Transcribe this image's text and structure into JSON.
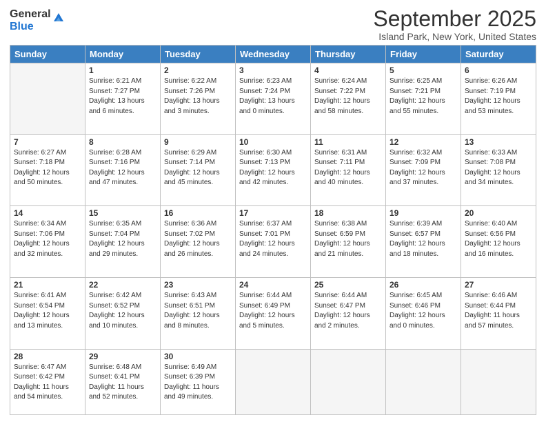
{
  "logo": {
    "general": "General",
    "blue": "Blue"
  },
  "title": "September 2025",
  "location": "Island Park, New York, United States",
  "days_of_week": [
    "Sunday",
    "Monday",
    "Tuesday",
    "Wednesday",
    "Thursday",
    "Friday",
    "Saturday"
  ],
  "weeks": [
    [
      {
        "day": "",
        "info": ""
      },
      {
        "day": "1",
        "info": "Sunrise: 6:21 AM\nSunset: 7:27 PM\nDaylight: 13 hours\nand 6 minutes."
      },
      {
        "day": "2",
        "info": "Sunrise: 6:22 AM\nSunset: 7:26 PM\nDaylight: 13 hours\nand 3 minutes."
      },
      {
        "day": "3",
        "info": "Sunrise: 6:23 AM\nSunset: 7:24 PM\nDaylight: 13 hours\nand 0 minutes."
      },
      {
        "day": "4",
        "info": "Sunrise: 6:24 AM\nSunset: 7:22 PM\nDaylight: 12 hours\nand 58 minutes."
      },
      {
        "day": "5",
        "info": "Sunrise: 6:25 AM\nSunset: 7:21 PM\nDaylight: 12 hours\nand 55 minutes."
      },
      {
        "day": "6",
        "info": "Sunrise: 6:26 AM\nSunset: 7:19 PM\nDaylight: 12 hours\nand 53 minutes."
      }
    ],
    [
      {
        "day": "7",
        "info": "Sunrise: 6:27 AM\nSunset: 7:18 PM\nDaylight: 12 hours\nand 50 minutes."
      },
      {
        "day": "8",
        "info": "Sunrise: 6:28 AM\nSunset: 7:16 PM\nDaylight: 12 hours\nand 47 minutes."
      },
      {
        "day": "9",
        "info": "Sunrise: 6:29 AM\nSunset: 7:14 PM\nDaylight: 12 hours\nand 45 minutes."
      },
      {
        "day": "10",
        "info": "Sunrise: 6:30 AM\nSunset: 7:13 PM\nDaylight: 12 hours\nand 42 minutes."
      },
      {
        "day": "11",
        "info": "Sunrise: 6:31 AM\nSunset: 7:11 PM\nDaylight: 12 hours\nand 40 minutes."
      },
      {
        "day": "12",
        "info": "Sunrise: 6:32 AM\nSunset: 7:09 PM\nDaylight: 12 hours\nand 37 minutes."
      },
      {
        "day": "13",
        "info": "Sunrise: 6:33 AM\nSunset: 7:08 PM\nDaylight: 12 hours\nand 34 minutes."
      }
    ],
    [
      {
        "day": "14",
        "info": "Sunrise: 6:34 AM\nSunset: 7:06 PM\nDaylight: 12 hours\nand 32 minutes."
      },
      {
        "day": "15",
        "info": "Sunrise: 6:35 AM\nSunset: 7:04 PM\nDaylight: 12 hours\nand 29 minutes."
      },
      {
        "day": "16",
        "info": "Sunrise: 6:36 AM\nSunset: 7:02 PM\nDaylight: 12 hours\nand 26 minutes."
      },
      {
        "day": "17",
        "info": "Sunrise: 6:37 AM\nSunset: 7:01 PM\nDaylight: 12 hours\nand 24 minutes."
      },
      {
        "day": "18",
        "info": "Sunrise: 6:38 AM\nSunset: 6:59 PM\nDaylight: 12 hours\nand 21 minutes."
      },
      {
        "day": "19",
        "info": "Sunrise: 6:39 AM\nSunset: 6:57 PM\nDaylight: 12 hours\nand 18 minutes."
      },
      {
        "day": "20",
        "info": "Sunrise: 6:40 AM\nSunset: 6:56 PM\nDaylight: 12 hours\nand 16 minutes."
      }
    ],
    [
      {
        "day": "21",
        "info": "Sunrise: 6:41 AM\nSunset: 6:54 PM\nDaylight: 12 hours\nand 13 minutes."
      },
      {
        "day": "22",
        "info": "Sunrise: 6:42 AM\nSunset: 6:52 PM\nDaylight: 12 hours\nand 10 minutes."
      },
      {
        "day": "23",
        "info": "Sunrise: 6:43 AM\nSunset: 6:51 PM\nDaylight: 12 hours\nand 8 minutes."
      },
      {
        "day": "24",
        "info": "Sunrise: 6:44 AM\nSunset: 6:49 PM\nDaylight: 12 hours\nand 5 minutes."
      },
      {
        "day": "25",
        "info": "Sunrise: 6:44 AM\nSunset: 6:47 PM\nDaylight: 12 hours\nand 2 minutes."
      },
      {
        "day": "26",
        "info": "Sunrise: 6:45 AM\nSunset: 6:46 PM\nDaylight: 12 hours\nand 0 minutes."
      },
      {
        "day": "27",
        "info": "Sunrise: 6:46 AM\nSunset: 6:44 PM\nDaylight: 11 hours\nand 57 minutes."
      }
    ],
    [
      {
        "day": "28",
        "info": "Sunrise: 6:47 AM\nSunset: 6:42 PM\nDaylight: 11 hours\nand 54 minutes."
      },
      {
        "day": "29",
        "info": "Sunrise: 6:48 AM\nSunset: 6:41 PM\nDaylight: 11 hours\nand 52 minutes."
      },
      {
        "day": "30",
        "info": "Sunrise: 6:49 AM\nSunset: 6:39 PM\nDaylight: 11 hours\nand 49 minutes."
      },
      {
        "day": "",
        "info": ""
      },
      {
        "day": "",
        "info": ""
      },
      {
        "day": "",
        "info": ""
      },
      {
        "day": "",
        "info": ""
      }
    ]
  ]
}
